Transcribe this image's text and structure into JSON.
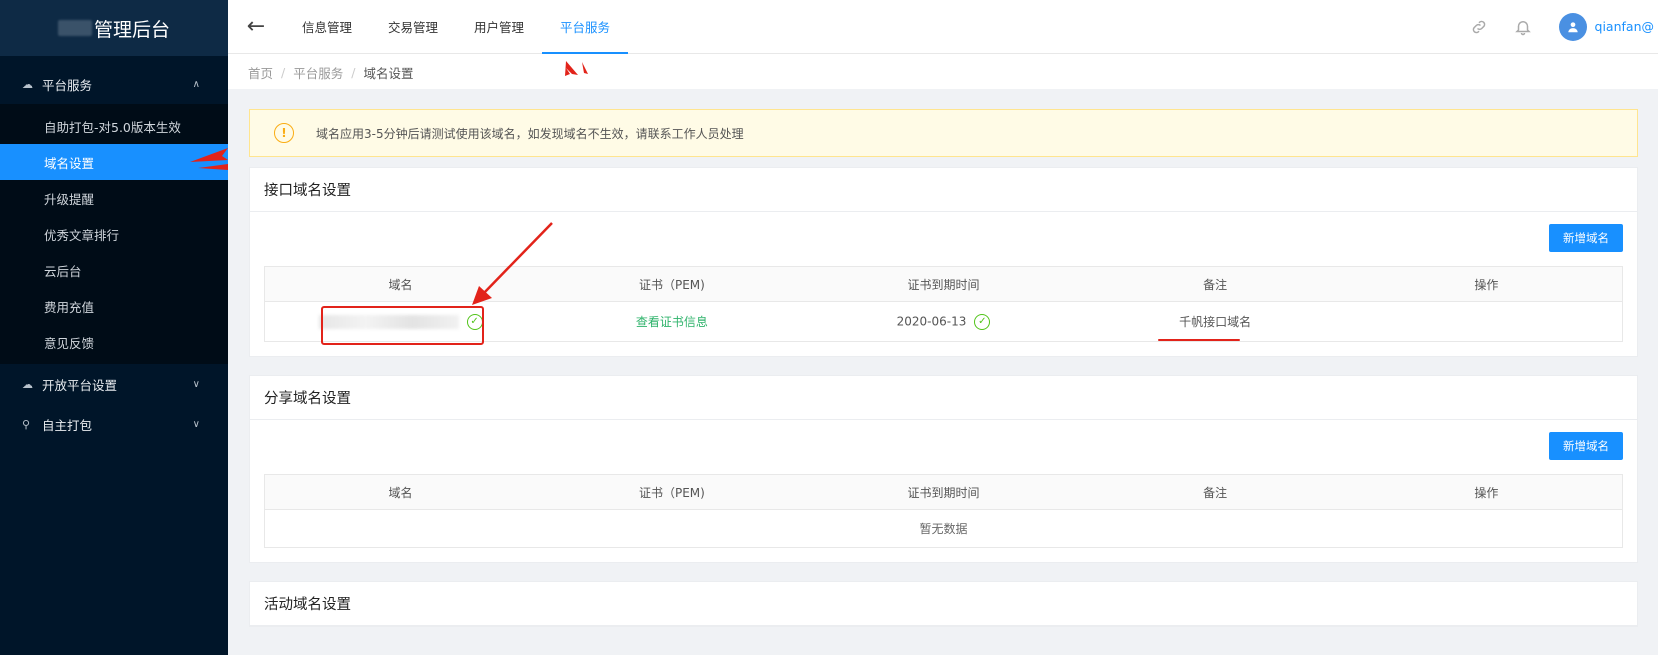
{
  "sidebar": {
    "brand_text": "管理后台",
    "groups": [
      {
        "label": "平台服务",
        "icon": "cloud-icon",
        "expanded": true
      },
      {
        "label": "开放平台设置",
        "icon": "cloud-icon",
        "expanded": false
      },
      {
        "label": "自主打包",
        "icon": "user-icon",
        "expanded": false
      }
    ],
    "submenu": [
      "自助打包-对5.0版本生效",
      "域名设置",
      "升级提醒",
      "优秀文章排行",
      "云后台",
      "费用充值",
      "意见反馈"
    ]
  },
  "topbar": {
    "tabs": [
      "信息管理",
      "交易管理",
      "用户管理",
      "平台服务"
    ],
    "active_tab": "平台服务",
    "username": "qianfan@"
  },
  "breadcrumb": [
    "首页",
    "平台服务",
    "域名设置"
  ],
  "alert": {
    "text": "域名应用3-5分钟后请测试使用该域名，如发现域名不生效，请联系工作人员处理"
  },
  "columns": [
    "域名",
    "证书（PEM)",
    "证书到期时间",
    "备注",
    "操作"
  ],
  "add_button": "新增域名",
  "sections": [
    {
      "title": "接口域名设置",
      "rows": [
        {
          "cert": "查看证书信息",
          "expiry": "2020-06-13",
          "note": "千帆接口域名"
        }
      ]
    },
    {
      "title": "分享域名设置",
      "empty_text": "暂无数据"
    },
    {
      "title": "活动域名设置"
    }
  ],
  "colors": {
    "sidebar_bg": "#001529",
    "accent": "#1890ff",
    "success": "#52c41a",
    "annotation": "#e2231a"
  }
}
